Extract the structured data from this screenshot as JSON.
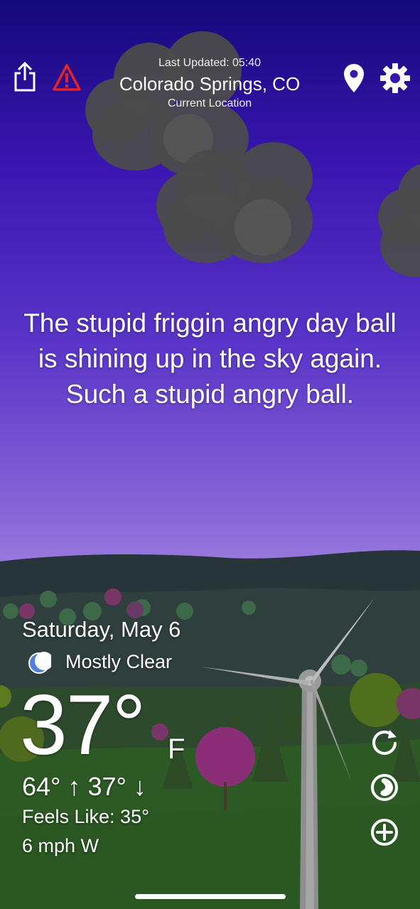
{
  "header": {
    "last_updated": "Last Updated: 05:40",
    "city": "Colorado Springs, CO",
    "location_label": "Current Location",
    "icons": [
      "share-icon",
      "alert-icon",
      "location-pin-icon",
      "gear-icon"
    ]
  },
  "quote": "The stupid friggin angry day ball is shining up in the sky again. Such a stupid angry ball.",
  "weather": {
    "date": "Saturday, May 6",
    "condition": "Mostly Clear",
    "condition_icon": "moon-icon",
    "temperature": "37°",
    "unit": "F",
    "high_low": "64° ↑ 37° ↓",
    "feels_like": "Feels Like: 35°",
    "wind": "6 mph W"
  },
  "side_buttons": [
    "refresh-icon",
    "radar-icon",
    "add-icon"
  ],
  "colors": {
    "sky_top": "#14087a",
    "sky_bottom": "#c9aaf4",
    "alert": "#e0242a",
    "moon": "#4d7fe0"
  }
}
